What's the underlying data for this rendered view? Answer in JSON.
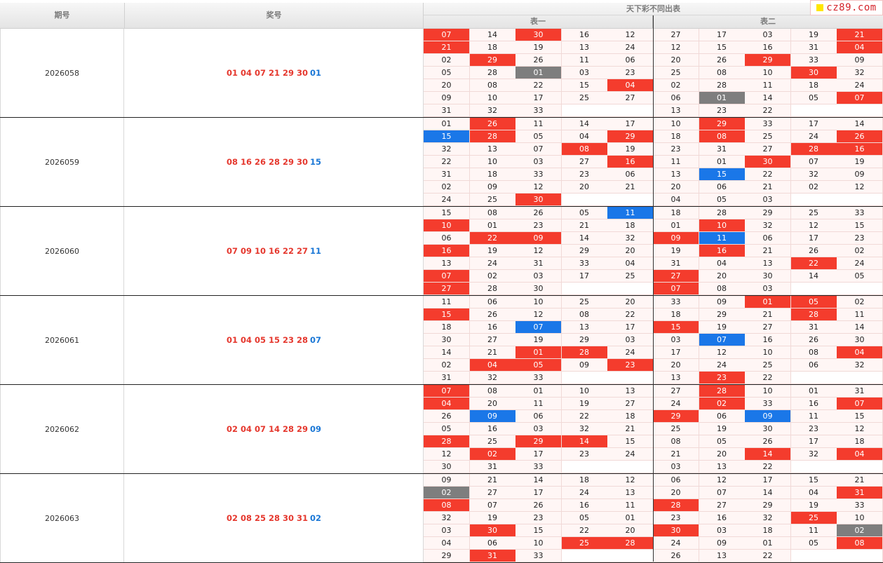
{
  "header": {
    "period_label": "期号",
    "result_label": "奖号",
    "table_group_label": "天下彩不同出表",
    "table1_label": "表一",
    "table2_label": "表二",
    "logo_text": "cz89.com"
  },
  "colors": {
    "highlight_red": "#f43c2d",
    "highlight_blue": "#1a77e8",
    "highlight_gray": "#7e7e7e",
    "result_red": "#e5382e",
    "result_blue": "#1a77d6"
  },
  "groups": [
    {
      "period": "2026058",
      "red_numbers": "01 04 07 21 29 30",
      "blue_number": "01",
      "t1": [
        [
          "07",
          "14",
          "30",
          "16",
          "12"
        ],
        [
          "21",
          "18",
          "19",
          "13",
          "24"
        ],
        [
          "02",
          "29",
          "26",
          "11",
          "06"
        ],
        [
          "05",
          "28",
          "01",
          "03",
          "23"
        ],
        [
          "20",
          "08",
          "22",
          "15",
          "04"
        ],
        [
          "09",
          "10",
          "17",
          "25",
          "27"
        ],
        [
          "31",
          "32",
          "33",
          "",
          ""
        ]
      ],
      "t1_hl": [
        [
          "r",
          "",
          "r",
          "",
          ""
        ],
        [
          "r",
          "",
          "",
          "",
          ""
        ],
        [
          "",
          "r",
          "",
          "",
          ""
        ],
        [
          "",
          "",
          "g",
          "",
          ""
        ],
        [
          "",
          "",
          "",
          "",
          "r"
        ],
        [
          "",
          "",
          "",
          "",
          ""
        ],
        [
          "",
          "",
          "",
          "",
          ""
        ]
      ],
      "t2": [
        [
          "27",
          "17",
          "03",
          "19",
          "21"
        ],
        [
          "12",
          "15",
          "16",
          "31",
          "04"
        ],
        [
          "20",
          "26",
          "29",
          "33",
          "09"
        ],
        [
          "25",
          "08",
          "10",
          "30",
          "32"
        ],
        [
          "02",
          "28",
          "11",
          "18",
          "24"
        ],
        [
          "06",
          "01",
          "14",
          "05",
          "07"
        ],
        [
          "13",
          "23",
          "22",
          "",
          ""
        ]
      ],
      "t2_hl": [
        [
          "",
          "",
          "",
          "",
          "r"
        ],
        [
          "",
          "",
          "",
          "",
          "r"
        ],
        [
          "",
          "",
          "r",
          "",
          ""
        ],
        [
          "",
          "",
          "",
          "r",
          ""
        ],
        [
          "",
          "",
          "",
          "",
          ""
        ],
        [
          "",
          "g",
          "",
          "",
          "r"
        ],
        [
          "",
          "",
          "",
          "",
          ""
        ]
      ]
    },
    {
      "period": "2026059",
      "red_numbers": "08 16 26 28 29 30",
      "blue_number": "15",
      "t1": [
        [
          "01",
          "26",
          "11",
          "14",
          "17"
        ],
        [
          "15",
          "28",
          "05",
          "04",
          "29"
        ],
        [
          "32",
          "13",
          "07",
          "08",
          "19"
        ],
        [
          "22",
          "10",
          "03",
          "27",
          "16"
        ],
        [
          "31",
          "18",
          "33",
          "23",
          "06"
        ],
        [
          "02",
          "09",
          "12",
          "20",
          "21"
        ],
        [
          "24",
          "25",
          "30",
          "",
          ""
        ]
      ],
      "t1_hl": [
        [
          "",
          "r",
          "",
          "",
          ""
        ],
        [
          "b",
          "r",
          "",
          "",
          "r"
        ],
        [
          "",
          "",
          "",
          "r",
          ""
        ],
        [
          "",
          "",
          "",
          "",
          "r"
        ],
        [
          "",
          "",
          "",
          "",
          ""
        ],
        [
          "",
          "",
          "",
          "",
          ""
        ],
        [
          "",
          "",
          "r",
          "",
          ""
        ]
      ],
      "t2": [
        [
          "10",
          "29",
          "33",
          "17",
          "14"
        ],
        [
          "18",
          "08",
          "25",
          "24",
          "26"
        ],
        [
          "23",
          "31",
          "27",
          "28",
          "16"
        ],
        [
          "11",
          "01",
          "30",
          "07",
          "19"
        ],
        [
          "13",
          "15",
          "22",
          "32",
          "09"
        ],
        [
          "20",
          "06",
          "21",
          "02",
          "12"
        ],
        [
          "04",
          "05",
          "03",
          "",
          ""
        ]
      ],
      "t2_hl": [
        [
          "",
          "r",
          "",
          "",
          ""
        ],
        [
          "",
          "r",
          "",
          "",
          "r"
        ],
        [
          "",
          "",
          "",
          "r",
          "r"
        ],
        [
          "",
          "",
          "r",
          "",
          ""
        ],
        [
          "",
          "b",
          "",
          "",
          ""
        ],
        [
          "",
          "",
          "",
          "",
          ""
        ],
        [
          "",
          "",
          "",
          "",
          ""
        ]
      ]
    },
    {
      "period": "2026060",
      "red_numbers": "07 09 10 16 22 27",
      "blue_number": "11",
      "t1": [
        [
          "15",
          "08",
          "26",
          "05",
          "11"
        ],
        [
          "10",
          "01",
          "23",
          "21",
          "18"
        ],
        [
          "06",
          "22",
          "09",
          "14",
          "32"
        ],
        [
          "16",
          "19",
          "12",
          "29",
          "20"
        ],
        [
          "13",
          "24",
          "31",
          "33",
          "04"
        ],
        [
          "07",
          "02",
          "03",
          "17",
          "25"
        ],
        [
          "27",
          "28",
          "30",
          "",
          ""
        ]
      ],
      "t1_hl": [
        [
          "",
          "",
          "",
          "",
          "b"
        ],
        [
          "r",
          "",
          "",
          "",
          ""
        ],
        [
          "",
          "r",
          "r",
          "",
          ""
        ],
        [
          "r",
          "",
          "",
          "",
          ""
        ],
        [
          "",
          "",
          "",
          "",
          ""
        ],
        [
          "r",
          "",
          "",
          "",
          ""
        ],
        [
          "r",
          "",
          "",
          "",
          ""
        ]
      ],
      "t2": [
        [
          "18",
          "28",
          "29",
          "25",
          "33"
        ],
        [
          "01",
          "10",
          "32",
          "12",
          "15"
        ],
        [
          "09",
          "11",
          "06",
          "17",
          "23"
        ],
        [
          "19",
          "16",
          "21",
          "26",
          "02"
        ],
        [
          "31",
          "04",
          "13",
          "22",
          "24"
        ],
        [
          "27",
          "20",
          "30",
          "14",
          "05"
        ],
        [
          "07",
          "08",
          "03",
          "",
          ""
        ]
      ],
      "t2_hl": [
        [
          "",
          "",
          "",
          "",
          ""
        ],
        [
          "",
          "r",
          "",
          "",
          ""
        ],
        [
          "r",
          "b",
          "",
          "",
          ""
        ],
        [
          "",
          "r",
          "",
          "",
          ""
        ],
        [
          "",
          "",
          "",
          "r",
          ""
        ],
        [
          "r",
          "",
          "",
          "",
          ""
        ],
        [
          "r",
          "",
          "",
          "",
          ""
        ]
      ]
    },
    {
      "period": "2026061",
      "red_numbers": "01 04 05 15 23 28",
      "blue_number": "07",
      "t1": [
        [
          "11",
          "06",
          "10",
          "25",
          "20"
        ],
        [
          "15",
          "26",
          "12",
          "08",
          "22"
        ],
        [
          "18",
          "16",
          "07",
          "13",
          "17"
        ],
        [
          "30",
          "27",
          "19",
          "29",
          "03"
        ],
        [
          "14",
          "21",
          "01",
          "28",
          "24"
        ],
        [
          "02",
          "04",
          "05",
          "09",
          "23"
        ],
        [
          "31",
          "32",
          "33",
          "",
          ""
        ]
      ],
      "t1_hl": [
        [
          "",
          "",
          "",
          "",
          ""
        ],
        [
          "r",
          "",
          "",
          "",
          ""
        ],
        [
          "",
          "",
          "b",
          "",
          ""
        ],
        [
          "",
          "",
          "",
          "",
          ""
        ],
        [
          "",
          "",
          "r",
          "r",
          ""
        ],
        [
          "",
          "r",
          "r",
          "",
          "r"
        ],
        [
          "",
          "",
          "",
          "",
          ""
        ]
      ],
      "t2": [
        [
          "33",
          "09",
          "01",
          "05",
          "02"
        ],
        [
          "18",
          "29",
          "21",
          "28",
          "11"
        ],
        [
          "15",
          "19",
          "27",
          "31",
          "14"
        ],
        [
          "03",
          "07",
          "16",
          "26",
          "30"
        ],
        [
          "17",
          "12",
          "10",
          "08",
          "04"
        ],
        [
          "20",
          "24",
          "25",
          "06",
          "32"
        ],
        [
          "13",
          "23",
          "22",
          "",
          ""
        ]
      ],
      "t2_hl": [
        [
          "",
          "",
          "r",
          "r",
          ""
        ],
        [
          "",
          "",
          "",
          "r",
          ""
        ],
        [
          "r",
          "",
          "",
          "",
          ""
        ],
        [
          "",
          "b",
          "",
          "",
          ""
        ],
        [
          "",
          "",
          "",
          "",
          "r"
        ],
        [
          "",
          "",
          "",
          "",
          ""
        ],
        [
          "",
          "r",
          "",
          "",
          ""
        ]
      ]
    },
    {
      "period": "2026062",
      "red_numbers": "02 04 07 14 28 29",
      "blue_number": "09",
      "t1": [
        [
          "07",
          "08",
          "01",
          "10",
          "13"
        ],
        [
          "04",
          "20",
          "11",
          "19",
          "27"
        ],
        [
          "26",
          "09",
          "06",
          "22",
          "18"
        ],
        [
          "05",
          "16",
          "03",
          "32",
          "21"
        ],
        [
          "28",
          "25",
          "29",
          "14",
          "15"
        ],
        [
          "12",
          "02",
          "17",
          "23",
          "24"
        ],
        [
          "30",
          "31",
          "33",
          "",
          ""
        ]
      ],
      "t1_hl": [
        [
          "r",
          "",
          "",
          "",
          ""
        ],
        [
          "r",
          "",
          "",
          "",
          ""
        ],
        [
          "",
          "b",
          "",
          "",
          ""
        ],
        [
          "",
          "",
          "",
          "",
          ""
        ],
        [
          "r",
          "",
          "r",
          "r",
          ""
        ],
        [
          "",
          "r",
          "",
          "",
          ""
        ],
        [
          "",
          "",
          "",
          "",
          ""
        ]
      ],
      "t2": [
        [
          "27",
          "28",
          "10",
          "01",
          "31"
        ],
        [
          "24",
          "02",
          "33",
          "16",
          "07"
        ],
        [
          "29",
          "06",
          "09",
          "11",
          "15"
        ],
        [
          "25",
          "19",
          "30",
          "23",
          "12"
        ],
        [
          "08",
          "05",
          "26",
          "17",
          "18"
        ],
        [
          "21",
          "20",
          "14",
          "32",
          "04"
        ],
        [
          "03",
          "13",
          "22",
          "",
          ""
        ]
      ],
      "t2_hl": [
        [
          "",
          "r",
          "",
          "",
          ""
        ],
        [
          "",
          "r",
          "",
          "",
          "r"
        ],
        [
          "r",
          "",
          "b",
          "",
          ""
        ],
        [
          "",
          "",
          "",
          "",
          ""
        ],
        [
          "",
          "",
          "",
          "",
          ""
        ],
        [
          "",
          "",
          "r",
          "",
          "r"
        ],
        [
          "",
          "",
          "",
          "",
          ""
        ]
      ]
    },
    {
      "period": "2026063",
      "red_numbers": "02 08 25 28 30 31",
      "blue_number": "02",
      "t1": [
        [
          "09",
          "21",
          "14",
          "18",
          "12"
        ],
        [
          "02",
          "27",
          "17",
          "24",
          "13"
        ],
        [
          "08",
          "07",
          "26",
          "16",
          "11"
        ],
        [
          "32",
          "19",
          "23",
          "05",
          "01"
        ],
        [
          "03",
          "30",
          "15",
          "22",
          "20"
        ],
        [
          "04",
          "06",
          "10",
          "25",
          "28"
        ],
        [
          "29",
          "31",
          "33",
          "",
          ""
        ]
      ],
      "t1_hl": [
        [
          "",
          "",
          "",
          "",
          ""
        ],
        [
          "g",
          "",
          "",
          "",
          ""
        ],
        [
          "r",
          "",
          "",
          "",
          ""
        ],
        [
          "",
          "",
          "",
          "",
          ""
        ],
        [
          "",
          "r",
          "",
          "",
          ""
        ],
        [
          "",
          "",
          "",
          "r",
          "r"
        ],
        [
          "",
          "r",
          "",
          "",
          ""
        ]
      ],
      "t2": [
        [
          "06",
          "12",
          "17",
          "15",
          "21"
        ],
        [
          "20",
          "07",
          "14",
          "04",
          "31"
        ],
        [
          "28",
          "27",
          "29",
          "19",
          "33"
        ],
        [
          "23",
          "16",
          "32",
          "25",
          "10"
        ],
        [
          "30",
          "03",
          "18",
          "11",
          "02"
        ],
        [
          "24",
          "09",
          "01",
          "05",
          "08"
        ],
        [
          "26",
          "13",
          "22",
          "",
          ""
        ]
      ],
      "t2_hl": [
        [
          "",
          "",
          "",
          "",
          ""
        ],
        [
          "",
          "",
          "",
          "",
          "r"
        ],
        [
          "r",
          "",
          "",
          "",
          ""
        ],
        [
          "",
          "",
          "",
          "r",
          ""
        ],
        [
          "r",
          "",
          "",
          "",
          "g"
        ],
        [
          "",
          "",
          "",
          "",
          "r"
        ],
        [
          "",
          "",
          "",
          "",
          ""
        ]
      ]
    }
  ]
}
